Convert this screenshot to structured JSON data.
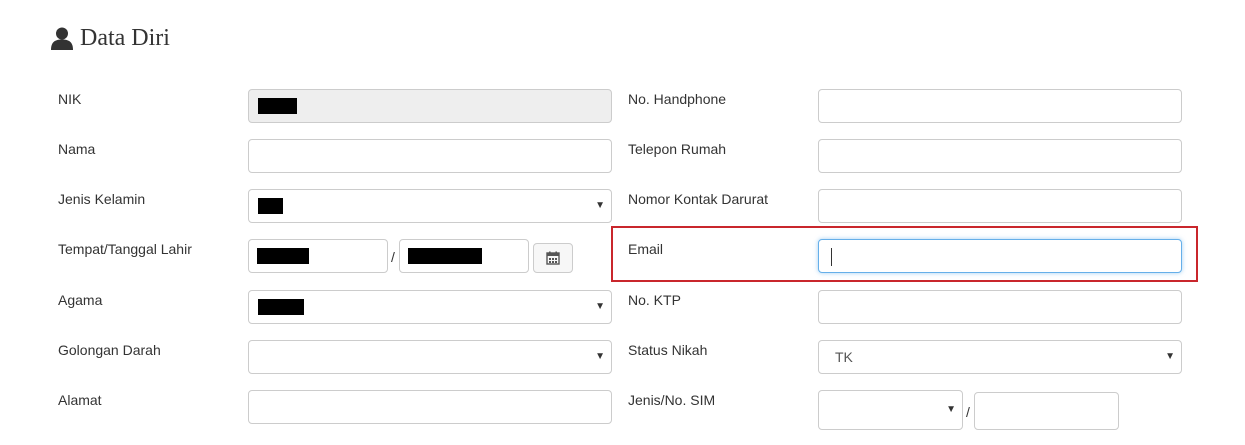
{
  "section": {
    "title": "Data Diri",
    "icon": "user-icon"
  },
  "left_form": {
    "nik": {
      "label": "NIK",
      "value_redacted": true
    },
    "nama": {
      "label": "Nama",
      "value": ""
    },
    "jenis_kelamin": {
      "label": "Jenis Kelamin",
      "value_redacted": true
    },
    "tempat_tanggal_lahir": {
      "label": "Tempat/Tanggal Lahir",
      "separator": "/",
      "tempat_redacted": true,
      "tanggal_redacted": true,
      "calendar_icon": "calendar-icon"
    },
    "agama": {
      "label": "Agama",
      "value_redacted": true
    },
    "golongan_darah": {
      "label": "Golongan Darah",
      "value": ""
    },
    "alamat": {
      "label": "Alamat",
      "value": ""
    }
  },
  "right_form": {
    "no_handphone": {
      "label": "No. Handphone",
      "value": ""
    },
    "telepon_rumah": {
      "label": "Telepon Rumah",
      "value": ""
    },
    "nomor_kontak_darurat": {
      "label": "Nomor Kontak Darurat",
      "value": ""
    },
    "email": {
      "label": "Email",
      "value": "",
      "focused": true
    },
    "no_ktp": {
      "label": "No. KTP",
      "value": ""
    },
    "status_nikah": {
      "label": "Status Nikah",
      "value": "TK"
    },
    "jenis_no_sim": {
      "label": "Jenis/No. SIM",
      "separator": "/",
      "jenis_value": "",
      "no_value": ""
    }
  },
  "colors": {
    "highlight": "#c9262c",
    "focus": "#66afe9",
    "disabled_bg": "#eeeeee",
    "border": "#cccccc"
  }
}
